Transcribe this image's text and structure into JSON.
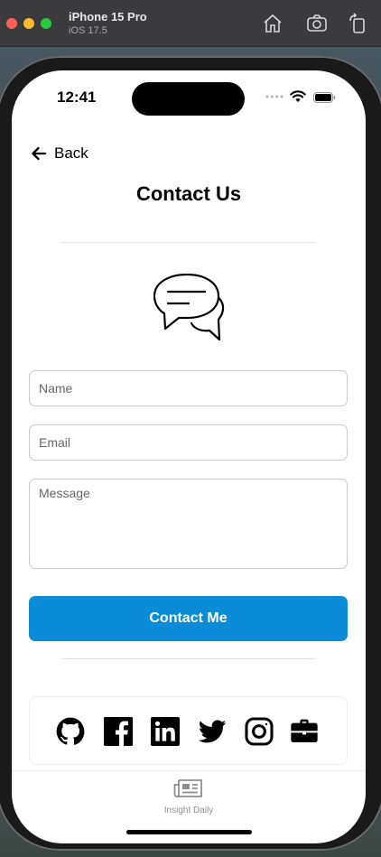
{
  "simulator": {
    "device_name": "iPhone 15 Pro",
    "os_version": "iOS 17.5",
    "icons": [
      "home-icon",
      "screenshot-icon",
      "rotate-icon"
    ]
  },
  "status_bar": {
    "time": "12:41"
  },
  "nav": {
    "back_label": "Back",
    "title": "Contact Us"
  },
  "form": {
    "name_placeholder": "Name",
    "email_placeholder": "Email",
    "message_placeholder": "Message",
    "submit_label": "Contact Me"
  },
  "social": [
    "github-icon",
    "facebook-icon",
    "linkedin-icon",
    "twitter-icon",
    "instagram-icon",
    "briefcase-icon"
  ],
  "tabbar": {
    "items": [
      {
        "label": "Insight Daily",
        "icon": "newspaper-icon"
      }
    ]
  },
  "colors": {
    "accent": "#0a8cd8",
    "text": "#000000",
    "muted": "#8e8e8e"
  }
}
